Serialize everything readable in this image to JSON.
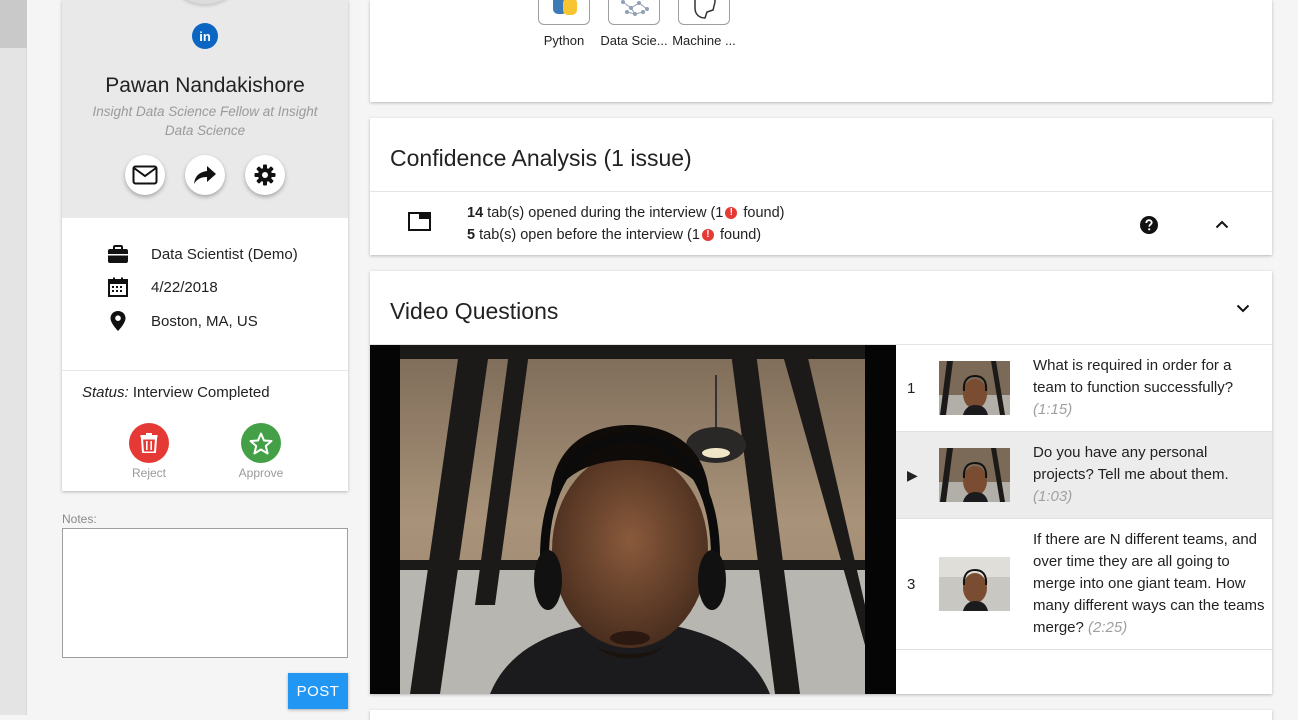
{
  "profile": {
    "linkedin_label": "in",
    "name": "Pawan Nandakishore",
    "headline": "Insight Data Science Fellow at Insight Data Science",
    "details": {
      "job": "Data Scientist (Demo)",
      "date": "4/22/2018",
      "location": "Boston, MA, US"
    },
    "status_label": "Status:",
    "status_value": "Interview Completed",
    "reject_label": "Reject",
    "approve_label": "Approve"
  },
  "notes": {
    "label": "Notes:",
    "value": "",
    "post_label": "POST"
  },
  "skills": [
    {
      "name": "Python",
      "icon": "python-logo-icon"
    },
    {
      "name": "Data Scie...",
      "icon": "network-icon"
    },
    {
      "name": "Machine ...",
      "icon": "brain-icon"
    }
  ],
  "confidence": {
    "title": "Confidence Analysis (1 issue)",
    "line1_count": "14",
    "line1_text": "tab(s) opened during the interview (1",
    "line1_suffix": "found)",
    "line2_count": "5",
    "line2_text": "tab(s) open before the interview (1",
    "line2_suffix": "found)",
    "alert_glyph": "!"
  },
  "video": {
    "title": "Video Questions",
    "questions": [
      {
        "number": "1",
        "text": "What is required in order for a team to function successfully?",
        "time": "(1:15)",
        "active": false
      },
      {
        "number": "▶",
        "text": "Do you have any personal projects? Tell me about them.",
        "time": "(1:03)",
        "active": true
      },
      {
        "number": "3",
        "text": "If there are N different teams, and over time they are all going to merge into one giant team. How many different ways can the teams merge?",
        "time": "(2:25)",
        "active": false
      }
    ]
  },
  "colors": {
    "primary": "#2196f3",
    "reject": "#e53935",
    "approve": "#43a047",
    "linkedin": "#0a66c2",
    "alert": "#e53935"
  }
}
